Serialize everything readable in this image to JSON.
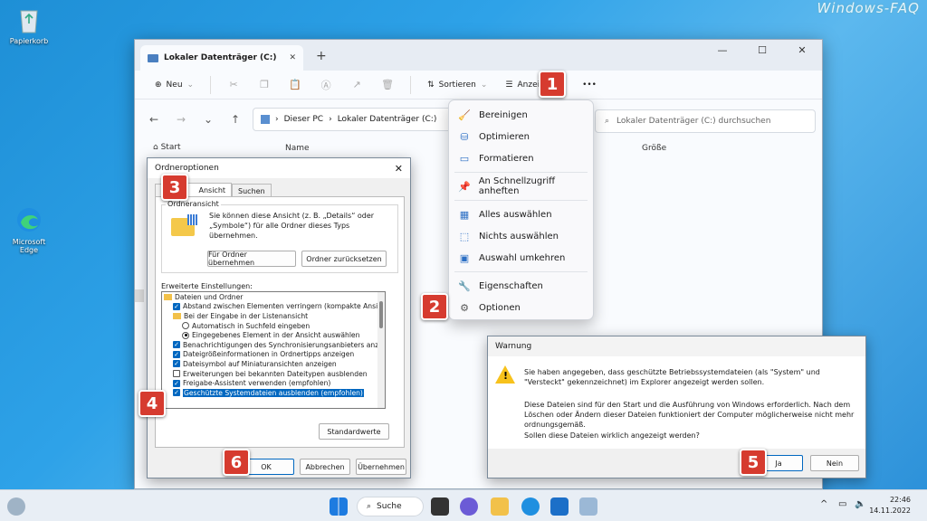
{
  "watermark": "Windows-FAQ",
  "desktop": {
    "recycle_bin": "Papierkorb",
    "edge": "Microsoft Edge"
  },
  "explorer": {
    "tab_title": "Lokaler Datenträger (C:)",
    "toolbar": {
      "new": "Neu",
      "sort": "Sortieren",
      "view": "Anzeigen",
      "more": "•••"
    },
    "breadcrumb": [
      "Dieser PC",
      "Lokaler Datenträger (C:)"
    ],
    "search_placeholder": "Lokaler Datenträger (C:) durchsuchen",
    "nav_start": "Start",
    "col_name": "Name",
    "col_size": "Größe"
  },
  "context_menu": {
    "items": [
      "Bereinigen",
      "Optimieren",
      "Formatieren",
      "An Schnellzugriff anheften",
      "Alles auswählen",
      "Nichts auswählen",
      "Auswahl umkehren",
      "Eigenschaften",
      "Optionen"
    ]
  },
  "badges": [
    "1",
    "2",
    "3",
    "4",
    "5",
    "6"
  ],
  "folder_options": {
    "title": "Ordneroptionen",
    "tabs": [
      "Allgemein",
      "Ansicht",
      "Suchen"
    ],
    "tab_general_visible": "A",
    "group_label": "Ordneransicht",
    "group_text": "Sie können diese Ansicht (z. B. „Details“ oder „Symbole“) für alle Ordner dieses Typs übernehmen.",
    "btn_apply": "Für Ordner übernehmen",
    "btn_reset": "Ordner zurücksetzen",
    "advanced_label": "Erweiterte Einstellungen:",
    "tree": [
      {
        "type": "folder",
        "text": "Dateien und Ordner"
      },
      {
        "type": "check",
        "on": true,
        "text": "Abstand zwischen Elementen verringern (kompakte Ansicht)"
      },
      {
        "type": "folder",
        "text": "Bei der Eingabe in der Listenansicht"
      },
      {
        "type": "radio",
        "on": false,
        "text": "Automatisch in Suchfeld eingeben"
      },
      {
        "type": "radio",
        "on": true,
        "text": "Eingegebenes Element in der Ansicht auswählen"
      },
      {
        "type": "check",
        "on": true,
        "text": "Benachrichtigungen des Synchronisierungsanbieters anzeigen"
      },
      {
        "type": "check",
        "on": true,
        "text": "Dateigrößeinformationen in Ordnertipps anzeigen"
      },
      {
        "type": "check",
        "on": true,
        "text": "Dateisymbol auf Miniaturansichten anzeigen"
      },
      {
        "type": "check",
        "on": false,
        "text": "Erweiterungen bei bekannten Dateitypen ausblenden"
      },
      {
        "type": "check",
        "on": true,
        "text": "Freigabe-Assistent verwenden (empfohlen)"
      },
      {
        "type": "check",
        "on": true,
        "text": "Geschützte Systemdateien ausblenden (empfohlen)",
        "selected": true
      }
    ],
    "btn_defaults": "Standardwerte",
    "btn_ok": "OK",
    "btn_cancel": "Abbrechen",
    "btn_apply2": "Übernehmen"
  },
  "warning": {
    "title": "Warnung",
    "line1": "Sie haben angegeben, dass geschützte Betriebssystemdateien (als \"System\" und \"Versteckt\" gekennzeichnet) im Explorer angezeigt werden sollen.",
    "line2": "Diese Dateien sind für den Start und die Ausführung von Windows erforderlich. Nach dem Löschen oder Ändern dieser Dateien funktioniert der Computer möglicherweise nicht mehr ordnungsgemäß.",
    "line3": "Sollen diese Dateien wirklich angezeigt werden?",
    "btn_yes": "Ja",
    "btn_no": "Nein"
  },
  "taskbar": {
    "search": "Suche",
    "time": "22:46",
    "date": "14.11.2022"
  }
}
